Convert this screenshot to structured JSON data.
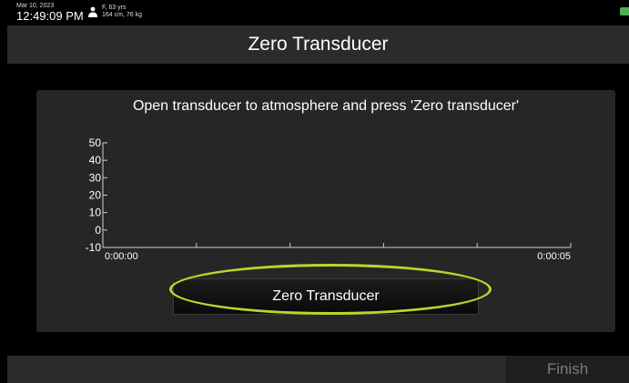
{
  "status": {
    "date": "Mar 10, 2023",
    "time": "12:49:09 PM",
    "patient_line1": "F, 63 yrs",
    "patient_line2": "164 cm, 76 kg",
    "patient_icon": "person-icon",
    "battery_icon": "battery-icon"
  },
  "header": {
    "title": "Zero Transducer"
  },
  "panel": {
    "instruction": "Open transducer to atmosphere and press 'Zero transducer'",
    "zero_button_label": "Zero Transducer"
  },
  "chart_data": {
    "type": "line",
    "y_ticks": [
      "50",
      "40",
      "30",
      "20",
      "10",
      "0",
      "-10"
    ],
    "y_values": [
      50,
      40,
      30,
      20,
      10,
      0,
      -10
    ],
    "ylim": [
      -10,
      50
    ],
    "x_start_label": "0:00:00",
    "x_end_label": "0:00:05",
    "x_minor_ticks": 5,
    "series": []
  },
  "footer": {
    "finish_label": "Finish"
  },
  "colors": {
    "highlight": "#b5d92a",
    "header_bg": "#2b2b2b",
    "panel_bg": "#262626",
    "battery": "#4caf50"
  }
}
